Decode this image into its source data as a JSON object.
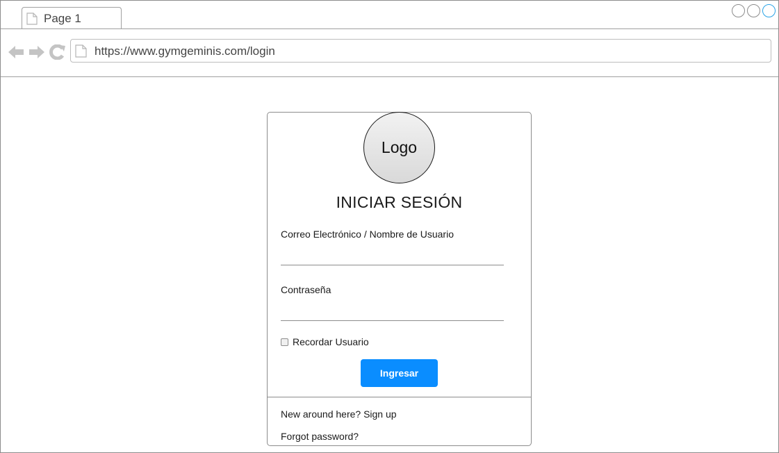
{
  "browser": {
    "tab_label": "Page 1",
    "url": "https://www.gymgeminis.com/login",
    "icons": [
      "back-arrow-icon",
      "forward-arrow-icon",
      "reload-icon",
      "document-icon"
    ],
    "window_controls": [
      "minimize",
      "maximize",
      "close"
    ]
  },
  "login": {
    "logo_text": "Logo",
    "title": "INICIAR SESIÓN",
    "username_label": "Correo Electrónico / Nombre de Usuario",
    "password_label": "Contraseña",
    "remember_label": "Recordar Usuario",
    "remember_checked": false,
    "submit_label": "Ingresar",
    "signup_text": "New around here? Sign up",
    "forgot_text": "Forgot password?"
  },
  "colors": {
    "primary_button": "#0a8dff",
    "close_control": "#29a3e6",
    "border": "#8c8c8c"
  }
}
